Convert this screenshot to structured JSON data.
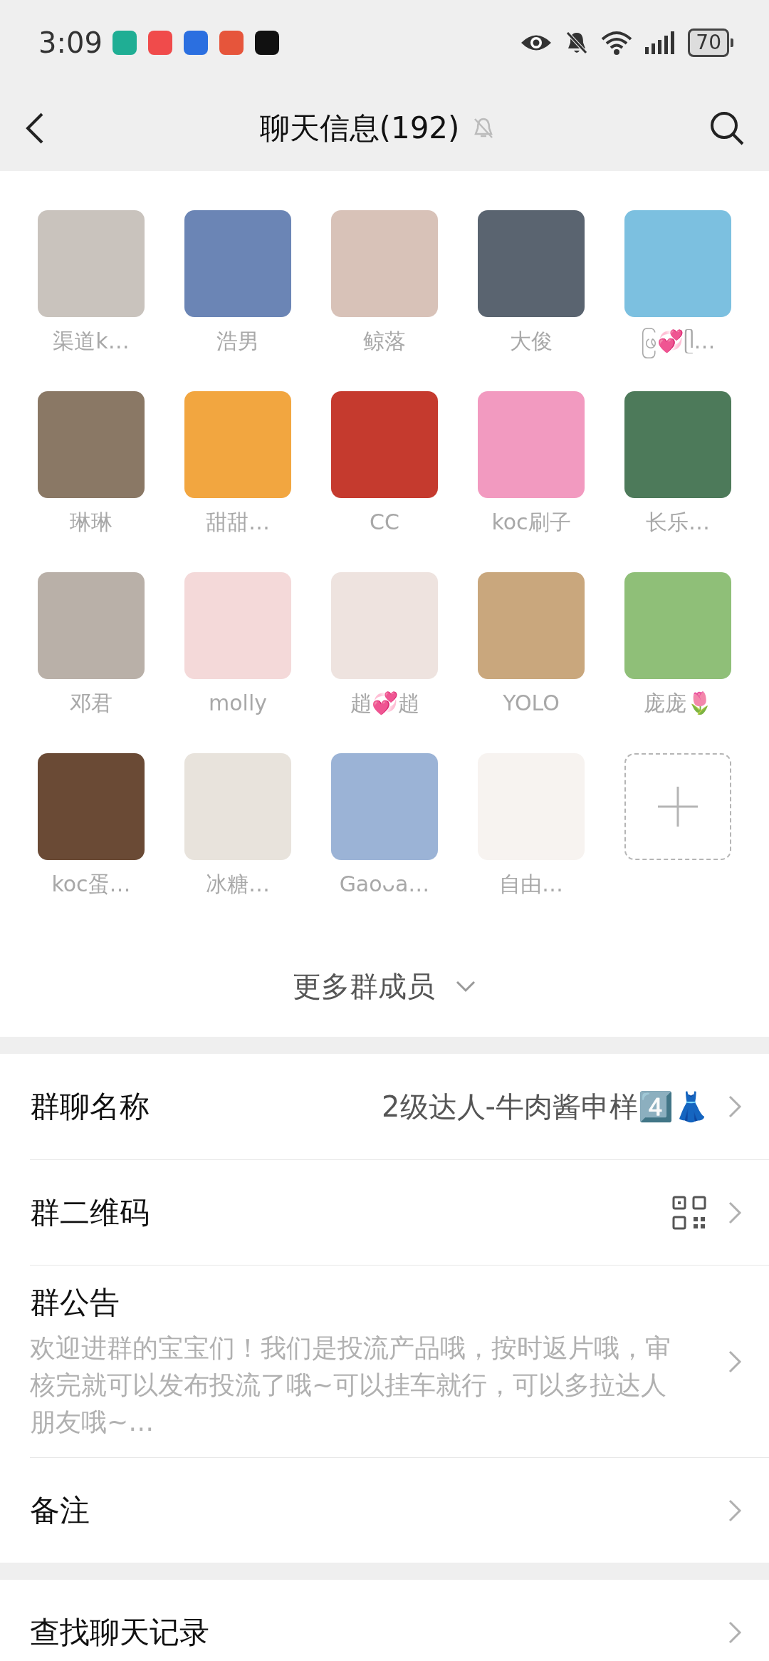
{
  "status_bar": {
    "time": "3:09",
    "battery": "70"
  },
  "header": {
    "title": "聊天信息(192)",
    "muted": true
  },
  "members": [
    {
      "name": "渠道k…"
    },
    {
      "name": "浩男"
    },
    {
      "name": "鲸落"
    },
    {
      "name": "大俊"
    },
    {
      "name": "ဖြ💞ᥫ…"
    },
    {
      "name": "琳琳"
    },
    {
      "name": "甜甜…"
    },
    {
      "name": "CC"
    },
    {
      "name": "koc刷子"
    },
    {
      "name": "长乐…"
    },
    {
      "name": "邓君"
    },
    {
      "name": "molly"
    },
    {
      "name": "趙💞趙"
    },
    {
      "name": "YOLO"
    },
    {
      "name": "庞庞🌷"
    },
    {
      "name": "koc蛋…"
    },
    {
      "name": "冰糖…"
    },
    {
      "name": "Gaoᴗa…"
    },
    {
      "name": "自由…"
    }
  ],
  "more_members": "更多群成员",
  "settings": [
    {
      "kind": "value",
      "label": "群聊名称",
      "value": "2级达人-牛肉酱申样4️⃣👗"
    },
    {
      "kind": "qr",
      "label": "群二维码"
    },
    {
      "kind": "notice",
      "label": "群公告",
      "description": "欢迎进群的宝宝们！我们是投流产品哦，按时返片哦，审核完就可以发布投流了哦~可以挂车就行，可以多拉达人朋友哦~…"
    },
    {
      "label": "备注"
    }
  ],
  "settings_2": [
    {
      "label": "查找聊天记录"
    }
  ]
}
